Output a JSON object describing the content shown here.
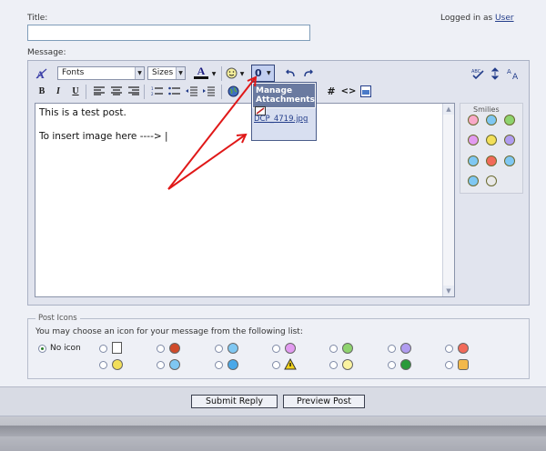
{
  "form": {
    "title_label": "Title:",
    "title_value": "",
    "message_label": "Message:",
    "logged_in_prefix": "Logged in as",
    "user_link": "User"
  },
  "toolbar": {
    "fonts_label": "Fonts",
    "sizes_label": "Sizes",
    "font_color_glyph": "A",
    "attach_glyph": "0",
    "bold": "B",
    "italic": "I",
    "underline": "U",
    "hash": "#",
    "code": "<>"
  },
  "dropdown": {
    "title": "Manage Attachments",
    "file": "DCP_4719.jpg"
  },
  "editor": {
    "lines": [
      "This is a test post.",
      "",
      "To insert image here ----> |"
    ]
  },
  "smilies": {
    "title": "Smilies"
  },
  "post_icons": {
    "legend": "Post Icons",
    "instruction": "You may choose an icon for your message from the following list:",
    "no_icon_label": "No icon"
  },
  "buttons": {
    "submit": "Submit Reply",
    "preview": "Preview Post"
  },
  "colors": {
    "accent": "#233d8a",
    "arrow": "#e01818",
    "dropdown_header": "#6a7aa0"
  }
}
